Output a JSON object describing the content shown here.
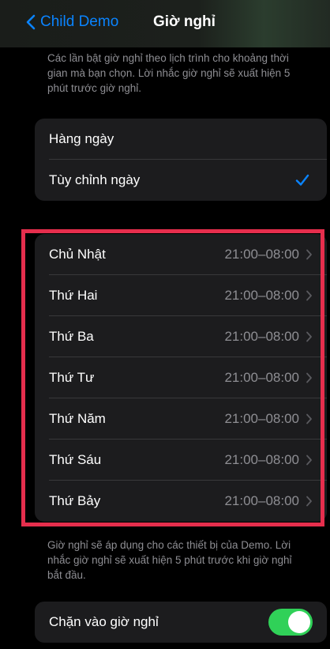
{
  "nav": {
    "back_label": "Child Demo",
    "title": "Giờ nghỉ"
  },
  "intro_text": "Các lần bật giờ nghỉ theo lịch trình cho khoảng thời gian mà bạn chọn. Lời nhắc giờ nghỉ sẽ xuất hiện 5 phút trước giờ nghỉ.",
  "schedule_options": [
    {
      "label": "Hàng ngày",
      "selected": false
    },
    {
      "label": "Tùy chỉnh ngày",
      "selected": true
    }
  ],
  "days": [
    {
      "label": "Chủ Nhật",
      "time": "21:00–08:00"
    },
    {
      "label": "Thứ Hai",
      "time": "21:00–08:00"
    },
    {
      "label": "Thứ Ba",
      "time": "21:00–08:00"
    },
    {
      "label": "Thứ Tư",
      "time": "21:00–08:00"
    },
    {
      "label": "Thứ Năm",
      "time": "21:00–08:00"
    },
    {
      "label": "Thứ Sáu",
      "time": "21:00–08:00"
    },
    {
      "label": "Thứ Bảy",
      "time": "21:00–08:00"
    }
  ],
  "days_footnote": "Giờ nghỉ sẽ áp dụng cho các thiết bị của Demo. Lời nhắc giờ nghỉ sẽ xuất hiện 5 phút trước khi giờ nghỉ bắt đầu.",
  "block_setting": {
    "label": "Chặn vào giờ nghỉ",
    "enabled": true
  },
  "colors": {
    "accent": "#0a84ff",
    "toggle_on": "#30d158",
    "highlight": "#e62e4d"
  }
}
